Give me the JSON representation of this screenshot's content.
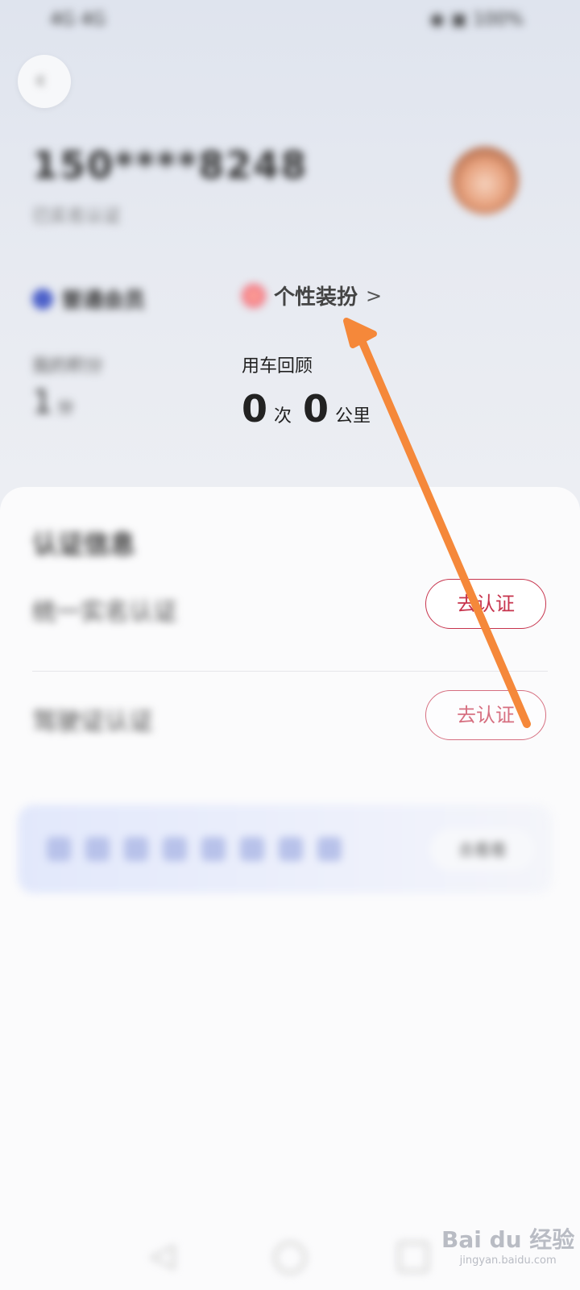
{
  "status_bar": {
    "left": "4G 4G",
    "right": "◉ ▣ 100%"
  },
  "back_icon": "chevron-left-icon",
  "profile": {
    "phone": "150****8248",
    "subtitle": "已实名认证"
  },
  "member": {
    "label": "普通会员"
  },
  "dress_up": {
    "label": "个性装扮",
    "chevron": ">"
  },
  "stats": {
    "left_label": "我的积分",
    "left_value": "1",
    "left_unit": "分",
    "ride_review_label": "用车回顾",
    "ride_count": "0",
    "ride_count_unit": "次",
    "ride_km": "0",
    "ride_km_unit": "公里"
  },
  "cert": {
    "title": "认证信息",
    "rows": [
      {
        "name": "统一实名认证",
        "button": "去认证"
      },
      {
        "name": "驾驶证认证",
        "button": "去认证"
      }
    ]
  },
  "banner": {
    "button": "去看看"
  },
  "watermark": {
    "main": "Bai du 经验",
    "url": "jingyan.baidu.com"
  },
  "colors": {
    "accent": "#c7344d",
    "annotation_arrow": "#f5883a"
  }
}
